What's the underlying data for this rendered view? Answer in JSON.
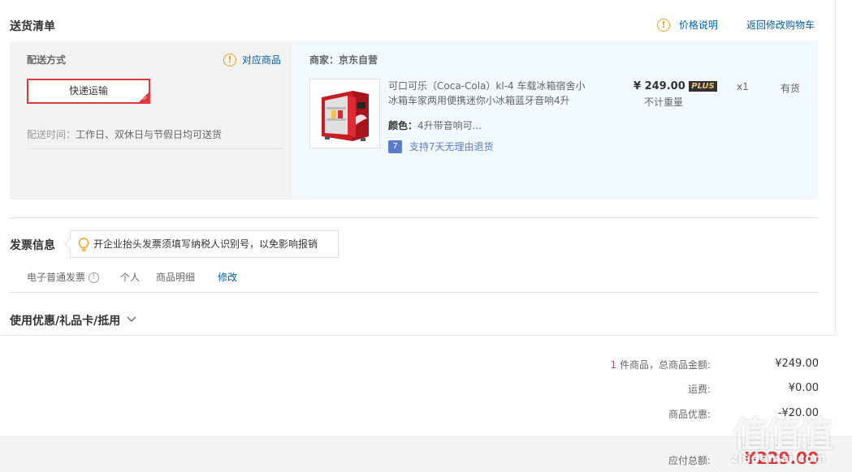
{
  "delivery": {
    "title": "送货清单",
    "price_explain": "价格说明",
    "back_to_cart": "返回修改购物车",
    "method_label": "配送方式",
    "match_goods": "对应商品",
    "method_value": "快递运输",
    "time_label": "配送时间：",
    "time_value": "工作日、双休日与节假日均可送货"
  },
  "goods": {
    "merchant_label": "商家：",
    "merchant_name": "京东自营",
    "name_line1": "可口可乐（Coca-Cola）kl-4 车载冰箱宿舍小",
    "name_line2": "冰箱车家两用便携迷你小冰箱蓝牙音响4升",
    "color_label": "颜色：",
    "color_value": "4升带音响可...",
    "return_icon": "7",
    "return_text": "支持7天无理由退货",
    "price": "¥ 249.00",
    "plus_badge": "PLUS",
    "weight_note": "不计重量",
    "quantity": "x1",
    "stock": "有货"
  },
  "invoice": {
    "title": "发票信息",
    "tip": "开企业抬头发票须填写纳税人识别号，以免影响报销",
    "type": "电子普通发票",
    "q_icon": "!",
    "holder": "个人",
    "content": "商品明细",
    "edit": "修改"
  },
  "coupon": {
    "title": "使用优惠/礼品卡/抵用"
  },
  "summary": {
    "count": "1",
    "count_suffix": " 件商品，总商品金额:",
    "total_value": "¥249.00",
    "freight_label": "运费:",
    "freight_value": "¥0.00",
    "discount_label": "商品优惠:",
    "discount_value": "-¥20.00",
    "payable_label": "应付总额:",
    "payable_value": "¥229.00"
  },
  "watermark": {
    "logo": "值",
    "site": "zhidemai.com"
  },
  "colors": {
    "accent_red": "#e4393c",
    "link_blue": "#005ea7",
    "warn_orange": "#f0a020",
    "goods_bg": "#f2f9fe"
  }
}
